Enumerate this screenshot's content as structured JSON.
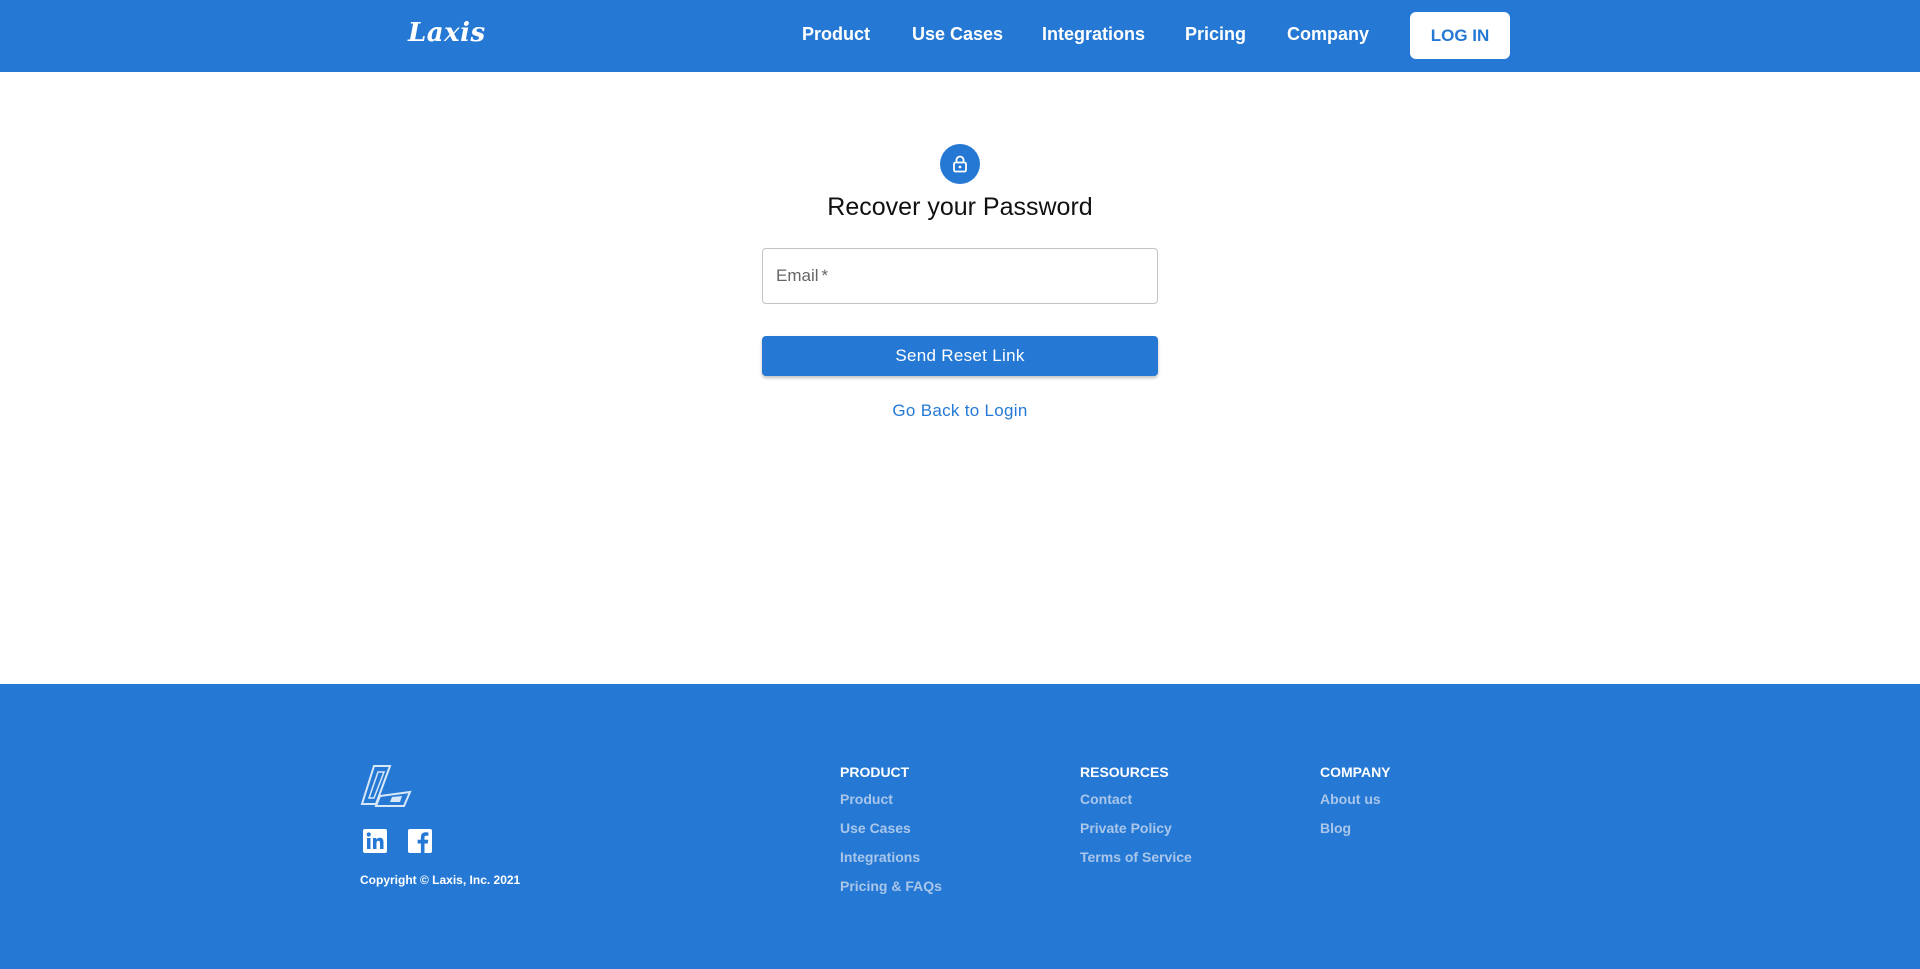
{
  "header": {
    "logo_text": "Laxis",
    "nav": [
      "Product",
      "Use Cases",
      "Integrations",
      "Pricing",
      "Company"
    ],
    "login_label": "LOG IN"
  },
  "main": {
    "icon": "lock-icon",
    "title": "Recover your Password",
    "email_label": "Email",
    "required_mark": "*",
    "send_button": "Send Reset Link",
    "back_link": "Go Back to Login"
  },
  "footer": {
    "social": [
      "linkedin-icon",
      "facebook-icon"
    ],
    "copyright": "Copyright © Laxis, Inc. 2021",
    "columns": [
      {
        "title": "PRODUCT",
        "links": [
          "Product",
          "Use Cases",
          "Integrations",
          "Pricing & FAQs"
        ]
      },
      {
        "title": "RESOURCES",
        "links": [
          "Contact",
          "Private Policy",
          "Terms of Service"
        ]
      },
      {
        "title": "COMPANY",
        "links": [
          "About us",
          "Blog"
        ]
      }
    ]
  },
  "colors": {
    "brand": "#2579d4",
    "footer_link": "#a9c6ea"
  }
}
